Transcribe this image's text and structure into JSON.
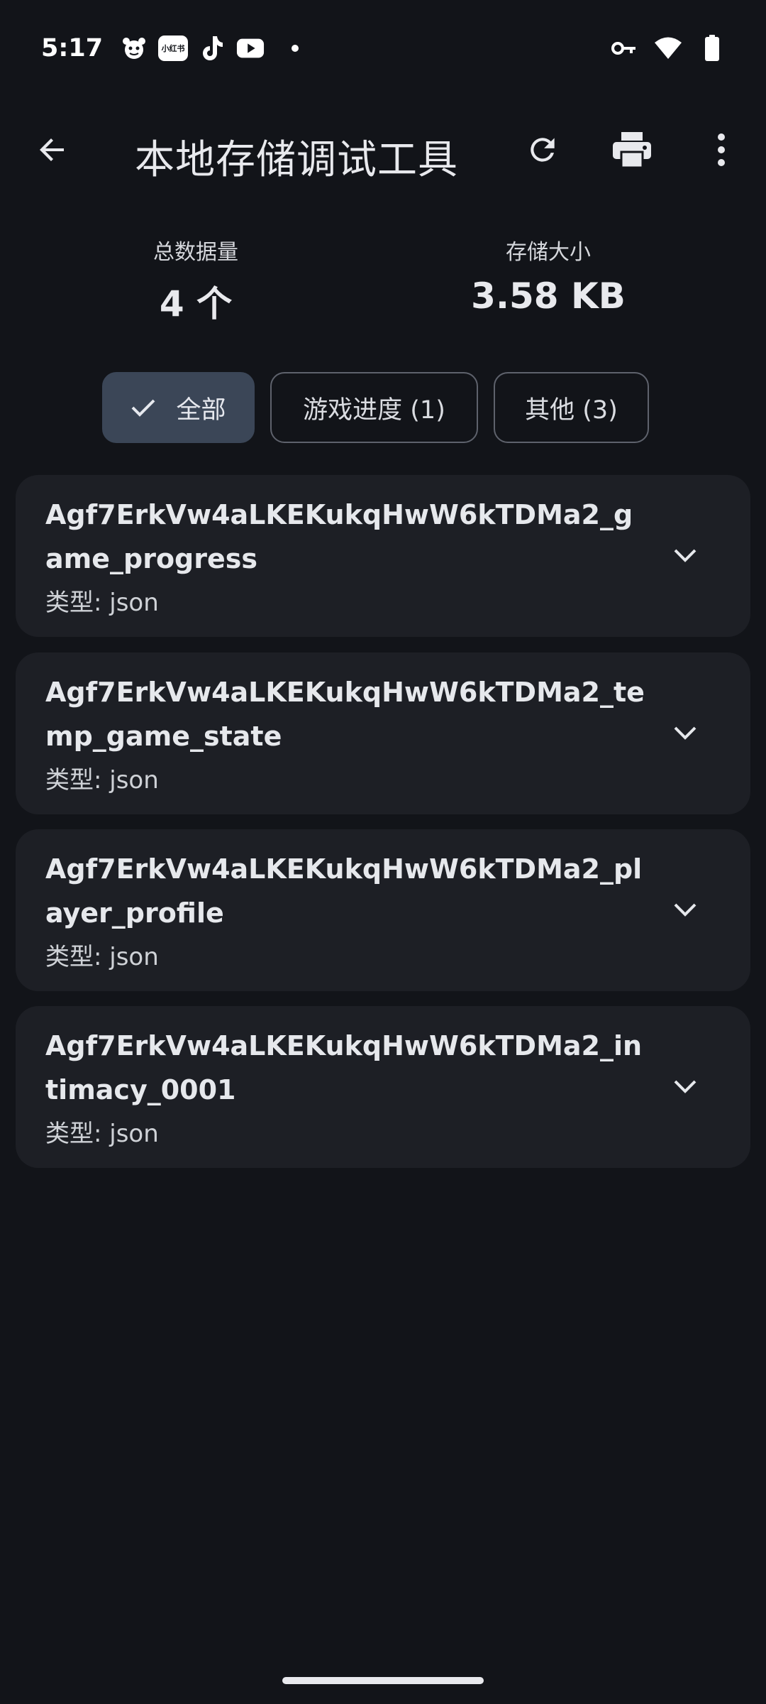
{
  "status_bar": {
    "time": "5:17",
    "xhs_badge": "小红书",
    "icons": [
      "mascot-icon",
      "xiaohongshu-icon",
      "tiktok-icon",
      "youtube-icon",
      "dot-icon",
      "vpn-key-icon",
      "wifi-icon",
      "battery-icon"
    ]
  },
  "app_bar": {
    "title": "本地存储调试工具",
    "icons": [
      "back-arrow-icon",
      "refresh-icon",
      "print-icon",
      "more-vert-icon"
    ]
  },
  "stats": {
    "total_label": "总数据量",
    "total_value": "4 个",
    "size_label": "存储大小",
    "size_value": "3.58 KB"
  },
  "filters": [
    {
      "label": "全部",
      "selected": true
    },
    {
      "label": "游戏进度 (1)",
      "selected": false
    },
    {
      "label": "其他 (3)",
      "selected": false
    }
  ],
  "items": [
    {
      "key": "Agf7ErkVw4aLKEKukqHwW6kTDMa2_game_progress",
      "type": "类型: json"
    },
    {
      "key": "Agf7ErkVw4aLKEKukqHwW6kTDMa2_temp_game_state",
      "type": "类型: json"
    },
    {
      "key": "Agf7ErkVw4aLKEKukqHwW6kTDMa2_player_profile",
      "type": "类型: json"
    },
    {
      "key": "Agf7ErkVw4aLKEKukqHwW6kTDMa2_intimacy_0001",
      "type": "类型: json"
    }
  ],
  "colors": {
    "background": "#121419",
    "card": "#1D1F25",
    "chip_selected": "#3B4657",
    "chip_border": "#5E626C",
    "text_primary": "#E6E8EC"
  }
}
